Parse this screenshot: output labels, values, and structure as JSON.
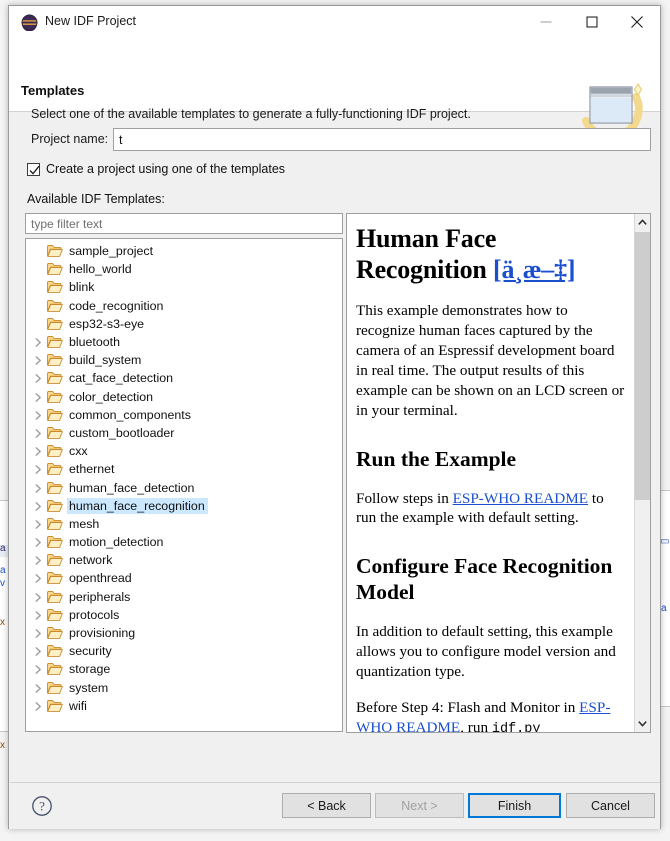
{
  "window": {
    "title": "New IDF Project",
    "app_icon": "espressif-logo-icon",
    "minimize": "minimize-icon",
    "maximize": "maximize-icon",
    "close": "close-icon"
  },
  "header": {
    "title": "Templates",
    "description": "Select one of the available templates to generate a fully-functioning IDF project.",
    "banner_icon": "new-project-wizard-icon"
  },
  "form": {
    "project_name_label": "Project name:",
    "project_name_value": "t",
    "checkbox_label": "Create a project using one of the templates",
    "checkbox_checked": true,
    "available_label": "Available IDF Templates:"
  },
  "filter": {
    "placeholder": "type filter text",
    "value": ""
  },
  "tree": {
    "selected": "human_face_recognition",
    "items": [
      {
        "label": "sample_project",
        "expandable": false
      },
      {
        "label": "hello_world",
        "expandable": false
      },
      {
        "label": "blink",
        "expandable": false
      },
      {
        "label": "code_recognition",
        "expandable": false
      },
      {
        "label": "esp32-s3-eye",
        "expandable": false
      },
      {
        "label": "bluetooth",
        "expandable": true
      },
      {
        "label": "build_system",
        "expandable": true
      },
      {
        "label": "cat_face_detection",
        "expandable": true
      },
      {
        "label": "color_detection",
        "expandable": true
      },
      {
        "label": "common_components",
        "expandable": true
      },
      {
        "label": "custom_bootloader",
        "expandable": true
      },
      {
        "label": "cxx",
        "expandable": true
      },
      {
        "label": "ethernet",
        "expandable": true
      },
      {
        "label": "human_face_detection",
        "expandable": true
      },
      {
        "label": "human_face_recognition",
        "expandable": true
      },
      {
        "label": "mesh",
        "expandable": true
      },
      {
        "label": "motion_detection",
        "expandable": true
      },
      {
        "label": "network",
        "expandable": true
      },
      {
        "label": "openthread",
        "expandable": true
      },
      {
        "label": "peripherals",
        "expandable": true
      },
      {
        "label": "protocols",
        "expandable": true
      },
      {
        "label": "provisioning",
        "expandable": true
      },
      {
        "label": "security",
        "expandable": true
      },
      {
        "label": "storage",
        "expandable": true
      },
      {
        "label": "system",
        "expandable": true
      },
      {
        "label": "wifi",
        "expandable": true
      }
    ]
  },
  "preview": {
    "title": "Human Face Recognition",
    "title_link": "[ä¸­æ–‡]",
    "para1": "This example demonstrates how to recognize human faces captured by the camera of an Espressif development board in real time. The output results of this example can be shown on an LCD screen or in your terminal.",
    "heading2": "Run the Example",
    "para2_before": "Follow steps in ",
    "para2_link": "ESP-WHO README",
    "para2_after": " to run the example with default setting.",
    "heading3": "Configure Face Recognition Model",
    "para3": "In addition to default setting, this example allows you to configure model version and quantization type.",
    "para4_before": "Before Step 4: Flash and Monitor in ",
    "para4_link": "ESP-WHO README",
    "para4_after": ", run ",
    "para4_code": "idf.py menuconfig"
  },
  "scrollbar": {
    "up_arrow": "chevron-up-icon",
    "down_arrow": "chevron-down-icon"
  },
  "footer": {
    "help": "help-icon",
    "back": "< Back",
    "next": "Next >",
    "next_disabled": true,
    "finish": "Finish",
    "cancel": "Cancel"
  },
  "colors": {
    "selection": "#cce8ff",
    "link": "#1a4fcf",
    "focus_border": "#0078d7",
    "dialog_bg": "#f0f0f0"
  }
}
